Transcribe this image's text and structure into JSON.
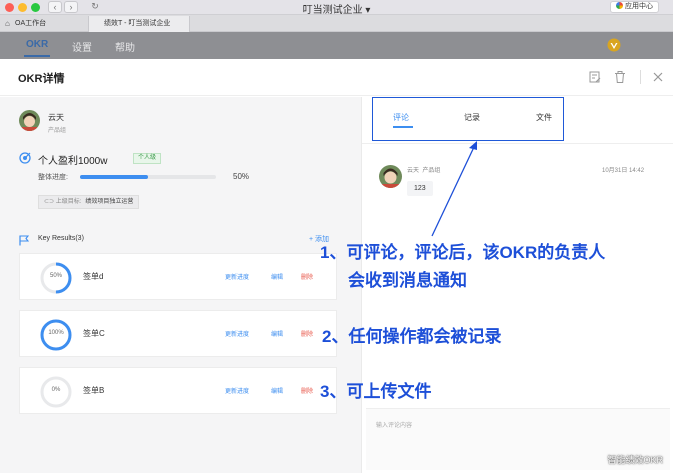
{
  "window": {
    "title": "叮当测试企业",
    "app_center": "应用中心"
  },
  "tabs": [
    {
      "label": "OA工作台"
    },
    {
      "label": "绩效T - 叮当测试企业"
    }
  ],
  "app_menu": {
    "okr": "OKR",
    "settings": "设置",
    "help": "帮助"
  },
  "modal": {
    "title": "OKR详情"
  },
  "owner": {
    "name": "云天",
    "dept": "产品组"
  },
  "objective": {
    "title": "个人盈利1000w",
    "tag": "个人级",
    "progress_label": "整体进度:",
    "progress": 50,
    "progress_text": "50%",
    "parent_label": "上级目标:",
    "parent_value": "绩效项目独立运营"
  },
  "key_results": {
    "title": "Key Results(3)",
    "add_label": "+ 添加",
    "actions": {
      "update": "更新进度",
      "edit": "编辑",
      "delete": "删除"
    },
    "items": [
      {
        "name": "签单d",
        "progress": 50,
        "progress_text": "50%"
      },
      {
        "name": "签单C",
        "progress": 100,
        "progress_text": "100%"
      },
      {
        "name": "签单B",
        "progress": 0,
        "progress_text": "0%"
      }
    ]
  },
  "right_panel": {
    "tabs": [
      "评论",
      "记录",
      "文件"
    ],
    "comment": {
      "author": "云天",
      "dept": "产品组",
      "time": "10月31日 14:42",
      "text": "123"
    },
    "input_placeholder": "输入评论内容"
  },
  "annotations": {
    "line1a": "1、可评论，评论后，该OKR的负责人",
    "line1b": "会收到消息通知",
    "line2": "2、任何操作都会被记录",
    "line3": "3、可上传文件"
  },
  "watermark": "智能绩效OKR",
  "colors": {
    "accent": "#3d8ef0",
    "annotation": "#1d4fd8",
    "delete": "#e8574a",
    "tag_green": "#3b9a4a"
  }
}
